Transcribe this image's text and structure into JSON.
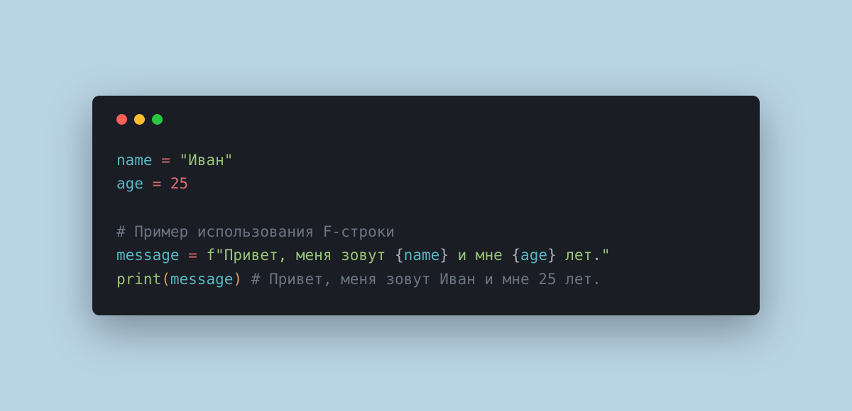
{
  "code": {
    "line1": {
      "var": "name",
      "op": " = ",
      "str": "\"Иван\""
    },
    "line2": {
      "var": "age",
      "op": " = ",
      "num": "25"
    },
    "line3": "",
    "line4": {
      "comment": "# Пример использования F-строки"
    },
    "line5": {
      "var": "message",
      "op": " = ",
      "fprefix": "f",
      "s1": "\"Привет, меня зовут ",
      "b1o": "{",
      "v1": "name",
      "b1c": "}",
      "s2": " и мне ",
      "b2o": "{",
      "v2": "age",
      "b2c": "}",
      "s3": " лет.\""
    },
    "line6": {
      "func": "print",
      "po": "(",
      "arg": "message",
      "pc": ")",
      "sp": " ",
      "comment": "# Привет, меня зовут Иван и мне 25 лет."
    }
  },
  "colors": {
    "background": "#b9d4e4",
    "window": "#1a1d23",
    "dot_red": "#ff5f57",
    "dot_yellow": "#febc2e",
    "dot_green": "#28c840",
    "variable": "#56b6c2",
    "operator": "#e06c75",
    "string": "#98c379",
    "number": "#e06c75",
    "comment": "#6b7484",
    "function": "#98c379",
    "paren": "#d19a66"
  }
}
